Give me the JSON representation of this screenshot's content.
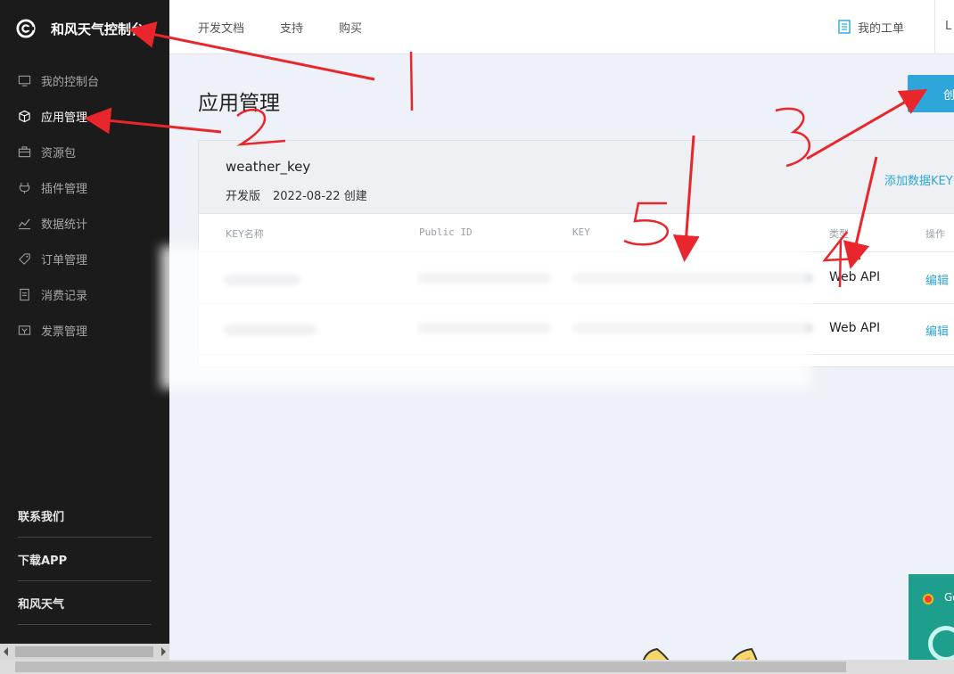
{
  "sidebar": {
    "brand_title": "和风天气控制台",
    "items": [
      {
        "label": "我的控制台",
        "icon": "monitor-icon",
        "active": false
      },
      {
        "label": "应用管理",
        "icon": "cube-icon",
        "active": true
      },
      {
        "label": "资源包",
        "icon": "briefcase-icon",
        "active": false
      },
      {
        "label": "插件管理",
        "icon": "plug-icon",
        "active": false
      },
      {
        "label": "数据统计",
        "icon": "chart-icon",
        "active": false
      },
      {
        "label": "订单管理",
        "icon": "tag-icon",
        "active": false
      },
      {
        "label": "消费记录",
        "icon": "receipt-icon",
        "active": false
      },
      {
        "label": "发票管理",
        "icon": "invoice-icon",
        "active": false
      }
    ],
    "bottom_links": [
      "联系我们",
      "下载APP",
      "和风天气"
    ]
  },
  "topbar": {
    "links": [
      "开发文档",
      "支持",
      "购买"
    ],
    "my_tickets": "我的工单",
    "user_truncated": "L"
  },
  "main": {
    "title": "应用管理",
    "create_button": "创",
    "app": {
      "name": "weather_key",
      "edition": "开发版",
      "created": "2022-08-22 创建",
      "add_key": "添加数据KEY"
    },
    "table": {
      "headers": [
        "KEY名称",
        "Public ID",
        "KEY",
        "类型",
        "操作"
      ],
      "rows": [
        {
          "type": "Web API",
          "action": "编辑"
        },
        {
          "type": "Web API",
          "action": "编辑"
        }
      ]
    }
  },
  "popup": {
    "text": "Go"
  },
  "annotations": [
    "1",
    "2",
    "3",
    "4",
    "5"
  ],
  "colors": {
    "sidebar_bg": "#1b1b1b",
    "accent": "#2fa6da",
    "annotation_red": "#e8262b"
  }
}
